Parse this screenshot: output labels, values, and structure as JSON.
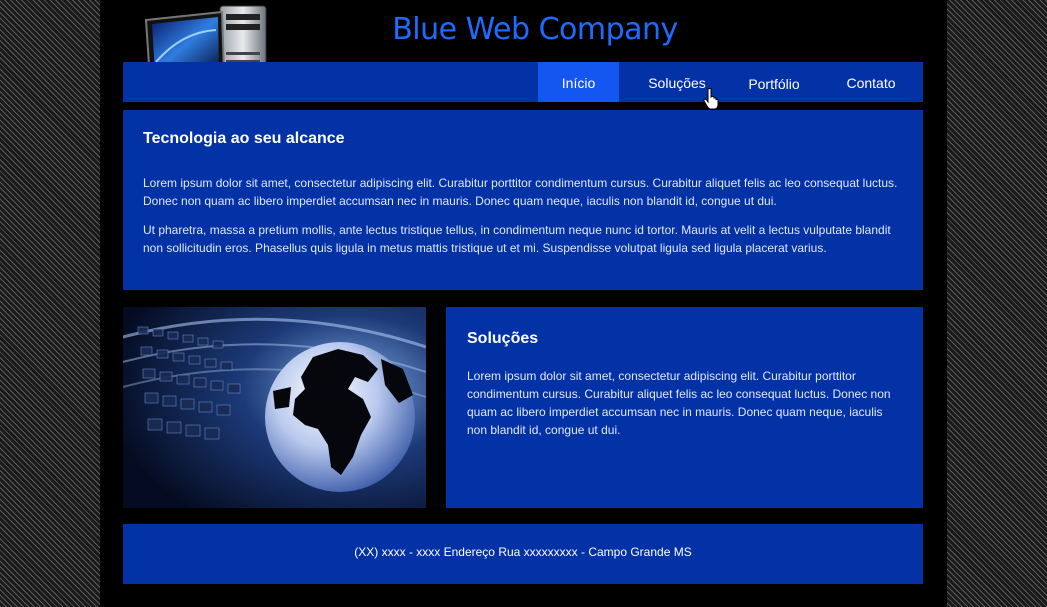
{
  "header": {
    "title": "Blue Web Company",
    "logo_icon": "computer-icon"
  },
  "nav": {
    "items": [
      {
        "label": "Início",
        "active": true
      },
      {
        "label": "Soluções",
        "active": false
      },
      {
        "label": "Portfólio",
        "active": false
      },
      {
        "label": "Contato",
        "active": false
      }
    ]
  },
  "intro": {
    "heading": "Tecnologia ao seu alcance",
    "paragraph1": "Lorem ipsum dolor sit amet, consectetur adipiscing elit. Curabitur porttitor condimentum cursus. Curabitur aliquet felis ac leo consequat luctus. Donec non quam ac libero imperdiet accumsan nec in mauris. Donec quam neque, iaculis non blandit id, congue ut dui.",
    "paragraph2": "Ut pharetra, massa a pretium mollis, ante lectus tristique tellus, in condimentum neque nunc id tortor. Mauris at velit a lectus vulputate blandit non sollicitudin eros. Phasellus quis ligula in metus mattis tristique ut et mi. Suspendisse volutpat ligula sed ligula placerat varius."
  },
  "solutions": {
    "heading": "Soluções",
    "paragraph": "Lorem ipsum dolor sit amet, consectetur adipiscing elit. Curabitur porttitor condimentum cursus. Curabitur aliquet felis ac leo consequat luctus. Donec non quam ac libero imperdiet accumsan nec in mauris. Donec quam neque, iaculis non blandit id, congue ut dui."
  },
  "footer": {
    "text": "(XX) xxxx - xxxx Endereço Rua xxxxxxxxx - Campo Grande MS"
  },
  "colors": {
    "accent": "#1457f0",
    "panel": "#0332a6",
    "title": "#1e6cff"
  }
}
